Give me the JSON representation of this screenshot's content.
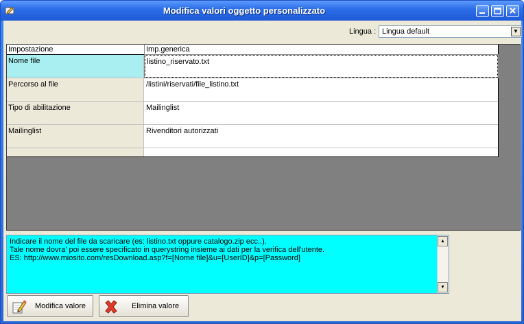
{
  "window": {
    "title": "Modifica valori oggetto personalizzato",
    "controls": {
      "minimize": "—",
      "maximize": "☐",
      "close": "✕"
    }
  },
  "lingua": {
    "label": "Lingua :",
    "selected": "Lingua default"
  },
  "grid": {
    "columns": [
      "Impostazione",
      "Imp.generica"
    ],
    "rows": [
      {
        "label": "Nome file",
        "value": "listino_riservato.txt"
      },
      {
        "label": "Percorso al file",
        "value": "/listini/riservati/file_listino.txt"
      },
      {
        "label": "Tipo di abilitazione",
        "value": "Mailinglist"
      },
      {
        "label": "Mailinglist",
        "value": "Rivenditori autorizzati"
      }
    ]
  },
  "description": {
    "text": "Indicare il nome del file da scaricare (es: listino.txt oppure catalogo.zip ecc..).\nTale nome dovra' poi essere specificato in querystring insieme ai dati per la verifica dell'utente.\nES: http://www.miosito.com/resDownload.asp?f=[Nome file]&u=[UserID]&p=[Password]"
  },
  "buttons": {
    "edit_label": "Modifica valore",
    "delete_label": "Elimina valore"
  },
  "icons": {
    "app": "app-icon",
    "edit": "edit-pencil-icon",
    "delete": "red-x-icon"
  }
}
